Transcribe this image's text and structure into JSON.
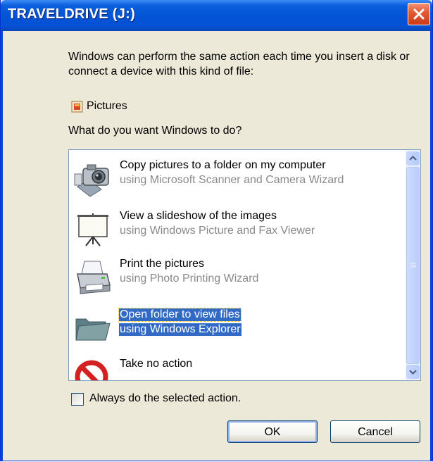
{
  "window": {
    "title": "TRAVELDRIVE (J:)"
  },
  "dialog": {
    "description": "Windows can perform the same action each time you insert a disk or connect a device with this kind of file:",
    "content_type_label": "Pictures",
    "question": "What do you want Windows to do?"
  },
  "actions": [
    {
      "title": "Copy pictures to a folder on my computer",
      "subtitle": "using Microsoft Scanner and Camera Wizard",
      "icon": "camera-icon",
      "selected": false
    },
    {
      "title": "View a slideshow of the images",
      "subtitle": "using Windows Picture and Fax Viewer",
      "icon": "slideshow-screen-icon",
      "selected": false
    },
    {
      "title": "Print the pictures",
      "subtitle": "using Photo Printing Wizard",
      "icon": "printer-icon",
      "selected": false
    },
    {
      "title": "Open folder to view files",
      "subtitle": "using Windows Explorer",
      "icon": "folder-icon",
      "selected": true
    },
    {
      "title": "Take no action",
      "subtitle": "",
      "icon": "no-action-icon",
      "selected": false
    }
  ],
  "always_checkbox": {
    "label": "Always do the selected action.",
    "checked": false
  },
  "buttons": {
    "ok": "OK",
    "cancel": "Cancel"
  },
  "colors": {
    "title_bar": "#0453d6",
    "selection": "#316ac5",
    "close_button": "#e35b34",
    "dialog_bg": "#ece9d8"
  }
}
